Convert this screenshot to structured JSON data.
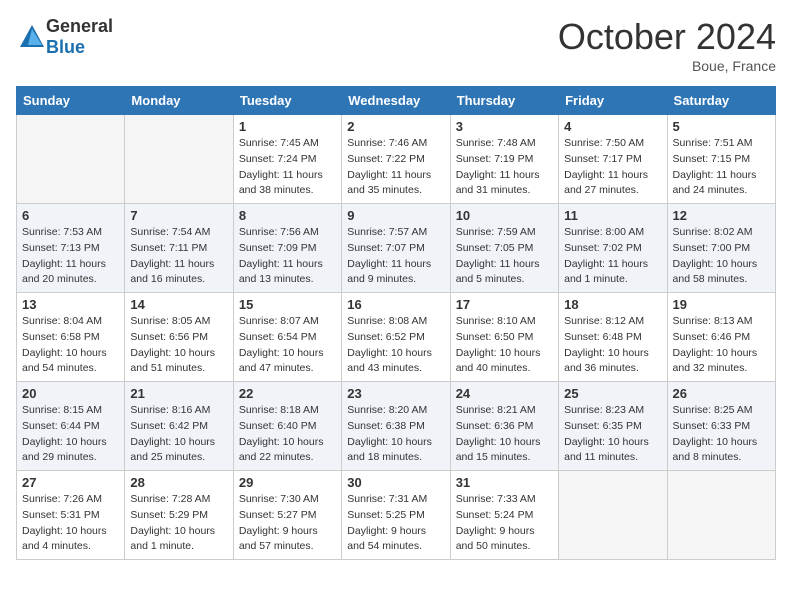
{
  "logo": {
    "general": "General",
    "blue": "Blue"
  },
  "title": "October 2024",
  "location": "Boue, France",
  "days_of_week": [
    "Sunday",
    "Monday",
    "Tuesday",
    "Wednesday",
    "Thursday",
    "Friday",
    "Saturday"
  ],
  "weeks": [
    [
      {
        "day": "",
        "empty": true
      },
      {
        "day": "",
        "empty": true
      },
      {
        "day": "1",
        "sunrise": "Sunrise: 7:45 AM",
        "sunset": "Sunset: 7:24 PM",
        "daylight": "Daylight: 11 hours and 38 minutes."
      },
      {
        "day": "2",
        "sunrise": "Sunrise: 7:46 AM",
        "sunset": "Sunset: 7:22 PM",
        "daylight": "Daylight: 11 hours and 35 minutes."
      },
      {
        "day": "3",
        "sunrise": "Sunrise: 7:48 AM",
        "sunset": "Sunset: 7:19 PM",
        "daylight": "Daylight: 11 hours and 31 minutes."
      },
      {
        "day": "4",
        "sunrise": "Sunrise: 7:50 AM",
        "sunset": "Sunset: 7:17 PM",
        "daylight": "Daylight: 11 hours and 27 minutes."
      },
      {
        "day": "5",
        "sunrise": "Sunrise: 7:51 AM",
        "sunset": "Sunset: 7:15 PM",
        "daylight": "Daylight: 11 hours and 24 minutes."
      }
    ],
    [
      {
        "day": "6",
        "sunrise": "Sunrise: 7:53 AM",
        "sunset": "Sunset: 7:13 PM",
        "daylight": "Daylight: 11 hours and 20 minutes."
      },
      {
        "day": "7",
        "sunrise": "Sunrise: 7:54 AM",
        "sunset": "Sunset: 7:11 PM",
        "daylight": "Daylight: 11 hours and 16 minutes."
      },
      {
        "day": "8",
        "sunrise": "Sunrise: 7:56 AM",
        "sunset": "Sunset: 7:09 PM",
        "daylight": "Daylight: 11 hours and 13 minutes."
      },
      {
        "day": "9",
        "sunrise": "Sunrise: 7:57 AM",
        "sunset": "Sunset: 7:07 PM",
        "daylight": "Daylight: 11 hours and 9 minutes."
      },
      {
        "day": "10",
        "sunrise": "Sunrise: 7:59 AM",
        "sunset": "Sunset: 7:05 PM",
        "daylight": "Daylight: 11 hours and 5 minutes."
      },
      {
        "day": "11",
        "sunrise": "Sunrise: 8:00 AM",
        "sunset": "Sunset: 7:02 PM",
        "daylight": "Daylight: 11 hours and 1 minute."
      },
      {
        "day": "12",
        "sunrise": "Sunrise: 8:02 AM",
        "sunset": "Sunset: 7:00 PM",
        "daylight": "Daylight: 10 hours and 58 minutes."
      }
    ],
    [
      {
        "day": "13",
        "sunrise": "Sunrise: 8:04 AM",
        "sunset": "Sunset: 6:58 PM",
        "daylight": "Daylight: 10 hours and 54 minutes."
      },
      {
        "day": "14",
        "sunrise": "Sunrise: 8:05 AM",
        "sunset": "Sunset: 6:56 PM",
        "daylight": "Daylight: 10 hours and 51 minutes."
      },
      {
        "day": "15",
        "sunrise": "Sunrise: 8:07 AM",
        "sunset": "Sunset: 6:54 PM",
        "daylight": "Daylight: 10 hours and 47 minutes."
      },
      {
        "day": "16",
        "sunrise": "Sunrise: 8:08 AM",
        "sunset": "Sunset: 6:52 PM",
        "daylight": "Daylight: 10 hours and 43 minutes."
      },
      {
        "day": "17",
        "sunrise": "Sunrise: 8:10 AM",
        "sunset": "Sunset: 6:50 PM",
        "daylight": "Daylight: 10 hours and 40 minutes."
      },
      {
        "day": "18",
        "sunrise": "Sunrise: 8:12 AM",
        "sunset": "Sunset: 6:48 PM",
        "daylight": "Daylight: 10 hours and 36 minutes."
      },
      {
        "day": "19",
        "sunrise": "Sunrise: 8:13 AM",
        "sunset": "Sunset: 6:46 PM",
        "daylight": "Daylight: 10 hours and 32 minutes."
      }
    ],
    [
      {
        "day": "20",
        "sunrise": "Sunrise: 8:15 AM",
        "sunset": "Sunset: 6:44 PM",
        "daylight": "Daylight: 10 hours and 29 minutes."
      },
      {
        "day": "21",
        "sunrise": "Sunrise: 8:16 AM",
        "sunset": "Sunset: 6:42 PM",
        "daylight": "Daylight: 10 hours and 25 minutes."
      },
      {
        "day": "22",
        "sunrise": "Sunrise: 8:18 AM",
        "sunset": "Sunset: 6:40 PM",
        "daylight": "Daylight: 10 hours and 22 minutes."
      },
      {
        "day": "23",
        "sunrise": "Sunrise: 8:20 AM",
        "sunset": "Sunset: 6:38 PM",
        "daylight": "Daylight: 10 hours and 18 minutes."
      },
      {
        "day": "24",
        "sunrise": "Sunrise: 8:21 AM",
        "sunset": "Sunset: 6:36 PM",
        "daylight": "Daylight: 10 hours and 15 minutes."
      },
      {
        "day": "25",
        "sunrise": "Sunrise: 8:23 AM",
        "sunset": "Sunset: 6:35 PM",
        "daylight": "Daylight: 10 hours and 11 minutes."
      },
      {
        "day": "26",
        "sunrise": "Sunrise: 8:25 AM",
        "sunset": "Sunset: 6:33 PM",
        "daylight": "Daylight: 10 hours and 8 minutes."
      }
    ],
    [
      {
        "day": "27",
        "sunrise": "Sunrise: 7:26 AM",
        "sunset": "Sunset: 5:31 PM",
        "daylight": "Daylight: 10 hours and 4 minutes."
      },
      {
        "day": "28",
        "sunrise": "Sunrise: 7:28 AM",
        "sunset": "Sunset: 5:29 PM",
        "daylight": "Daylight: 10 hours and 1 minute."
      },
      {
        "day": "29",
        "sunrise": "Sunrise: 7:30 AM",
        "sunset": "Sunset: 5:27 PM",
        "daylight": "Daylight: 9 hours and 57 minutes."
      },
      {
        "day": "30",
        "sunrise": "Sunrise: 7:31 AM",
        "sunset": "Sunset: 5:25 PM",
        "daylight": "Daylight: 9 hours and 54 minutes."
      },
      {
        "day": "31",
        "sunrise": "Sunrise: 7:33 AM",
        "sunset": "Sunset: 5:24 PM",
        "daylight": "Daylight: 9 hours and 50 minutes."
      },
      {
        "day": "",
        "empty": true
      },
      {
        "day": "",
        "empty": true
      }
    ]
  ]
}
